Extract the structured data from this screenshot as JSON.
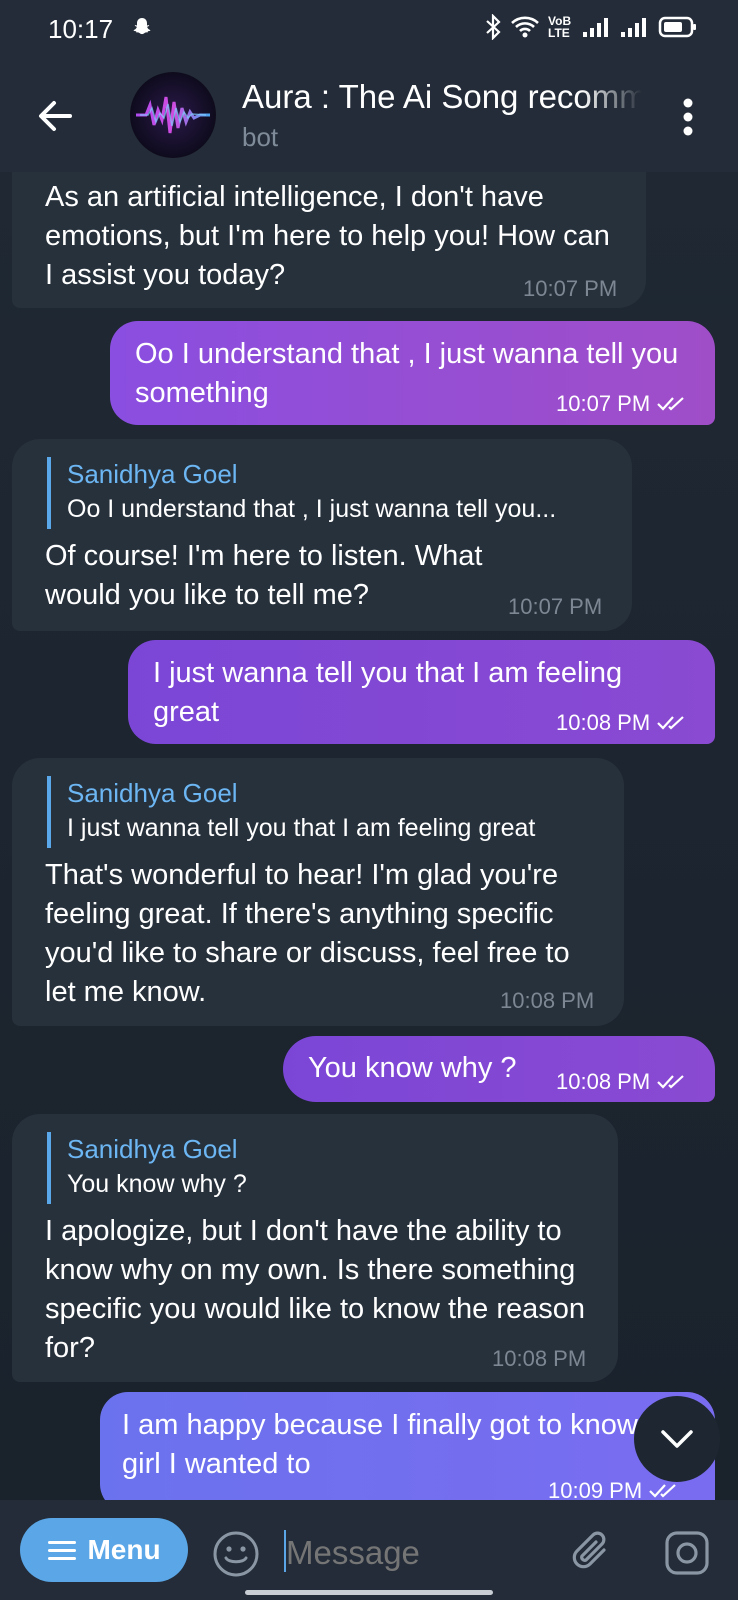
{
  "status_bar": {
    "time": "10:17",
    "network_label": "VoB LTE"
  },
  "header": {
    "title": "Aura : The Ai Song recommender",
    "subtitle": "bot"
  },
  "messages": [
    {
      "text": "As an artificial intelligence, I don't have emotions, but I'm here to help you! How can I assist you today?",
      "time": "10:07 PM"
    },
    {
      "text": "Oo I understand that , I just wanna tell you something",
      "time": "10:07 PM"
    },
    {
      "reply_name": "Sanidhya Goel",
      "reply_text": "Oo I understand that , I just wanna tell you...",
      "text": "Of course! I'm here to listen. What would you like to tell me?",
      "time": "10:07 PM"
    },
    {
      "text": "I just wanna tell you that I am feeling great",
      "time": "10:08 PM"
    },
    {
      "reply_name": "Sanidhya Goel",
      "reply_text": "I just wanna tell you that I am feeling great",
      "text": "That's wonderful to hear! I'm glad you're feeling great. If there's anything specific you'd like to share or discuss, feel free to let me know.",
      "time": "10:08 PM"
    },
    {
      "text": "You know why ?",
      "time": "10:08 PM"
    },
    {
      "reply_name": "Sanidhya Goel",
      "reply_text": "You know why ?",
      "text": "I apologize, but I don't have the ability to know why on my own. Is there something specific you would like to know the reason for?",
      "time": "10:08 PM"
    },
    {
      "text": "I am happy because I finally got to know the girl I wanted to",
      "time": "10:09 PM"
    }
  ],
  "input": {
    "menu_label": "Menu",
    "placeholder": "Message"
  },
  "icons": {
    "back": "arrow-left-icon",
    "more": "more-vertical-icon",
    "emoji": "smile-icon",
    "attach": "paperclip-icon",
    "camera": "camera-icon",
    "scroll_down": "chevron-down-icon",
    "read": "double-check-icon"
  },
  "colors": {
    "background": "#1c242e",
    "header": "#232c38",
    "incoming_bubble": "#27313c",
    "outgoing_bubble": "#9a4ed0",
    "accent": "#5aa6e6",
    "reply_name": "#6cb6f3"
  }
}
